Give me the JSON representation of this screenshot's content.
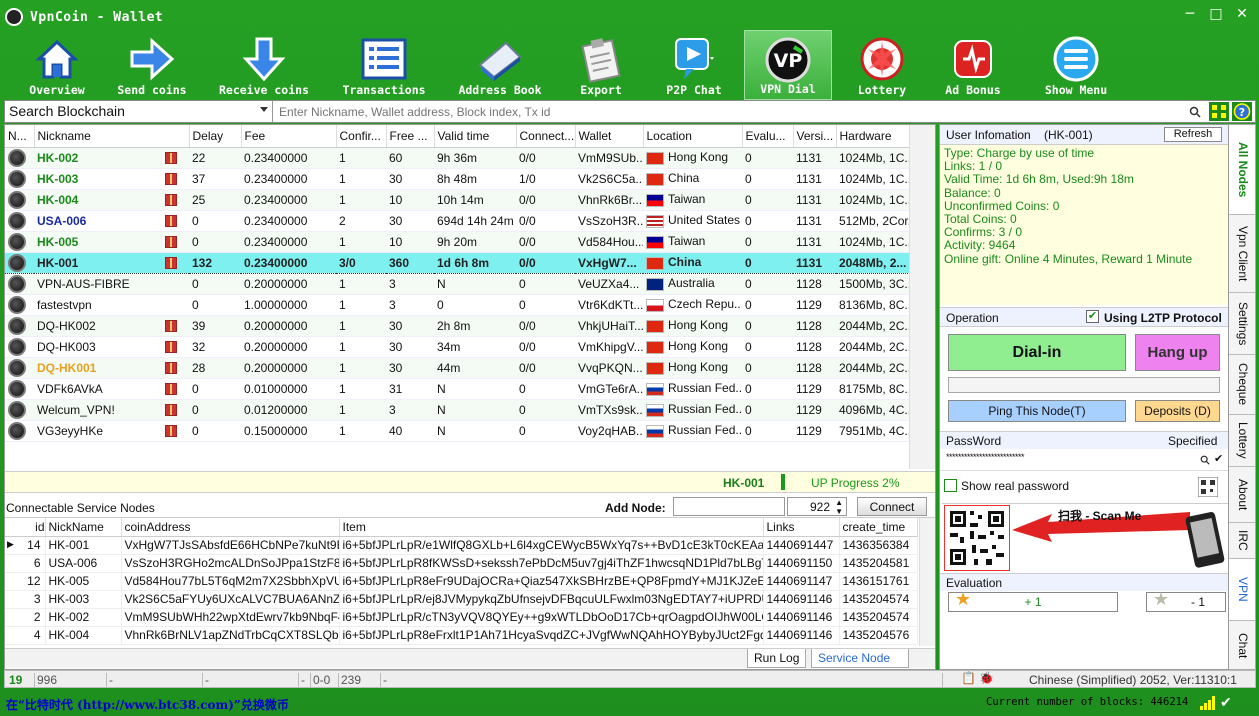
{
  "window": {
    "title": "VpnCoin - Wallet",
    "min": "─",
    "max": "□",
    "close": "✕",
    "logo_text": "V"
  },
  "toolbar": [
    {
      "name": "overview",
      "label": "Overview",
      "icon": "house-icon"
    },
    {
      "name": "send-coins",
      "label": "Send coins",
      "icon": "arrow-right-icon"
    },
    {
      "name": "receive-coins",
      "label": "Receive coins",
      "icon": "arrow-down-icon"
    },
    {
      "name": "transactions",
      "label": "Transactions",
      "icon": "list-icon"
    },
    {
      "name": "address-book",
      "label": "Address Book",
      "icon": "book-icon"
    },
    {
      "name": "export",
      "label": "Export",
      "icon": "clipboard-icon"
    },
    {
      "name": "p2p-chat",
      "label": "P2P Chat",
      "icon": "video-chat-icon"
    },
    {
      "name": "vpn-dial",
      "label": "VPN Dial",
      "icon": "vpn-logo-icon"
    },
    {
      "name": "lottery",
      "label": "Lottery",
      "icon": "lottery-icon"
    },
    {
      "name": "ad-bonus",
      "label": "Ad Bonus",
      "icon": "bonus-icon"
    },
    {
      "name": "show-menu",
      "label": "Show Menu",
      "icon": "menu-icon"
    }
  ],
  "search": {
    "selected": "Search Blockchain",
    "placeholder": "Enter Nickname, Wallet address, Block index, Tx id"
  },
  "nodes": {
    "columns": [
      "N...",
      "Nickname",
      "Delay",
      "Fee",
      "Confir...",
      "Free ...",
      "Valid time",
      "Connect...",
      "Wallet",
      "Location",
      "Evalu...",
      "Versi...",
      "Hardware"
    ],
    "rows": [
      {
        "nick": "HK-002",
        "color": "green",
        "gift": true,
        "delay": "22",
        "fee": "0.23400000",
        "confirm": "1",
        "free": "60",
        "valid": "9h 36m",
        "connect": "0/0",
        "wallet": "VmM9SUb...",
        "flag": "hk",
        "location": "Hong Kong",
        "eval": "0",
        "version": "1131",
        "hardware": "1024Mb, 1C..."
      },
      {
        "nick": "HK-003",
        "color": "green",
        "gift": true,
        "delay": "37",
        "fee": "0.23400000",
        "confirm": "1",
        "free": "30",
        "valid": "8h 48m",
        "connect": "1/0",
        "wallet": "Vk2S6C5a...",
        "flag": "cn",
        "location": "China",
        "eval": "0",
        "version": "1131",
        "hardware": "1024Mb, 1C..."
      },
      {
        "nick": "HK-004",
        "color": "green",
        "gift": true,
        "delay": "25",
        "fee": "0.23400000",
        "confirm": "1",
        "free": "10",
        "valid": "10h 14m",
        "connect": "0/0",
        "wallet": "VhnRk6Br...",
        "flag": "tw",
        "location": "Taiwan",
        "eval": "0",
        "version": "1131",
        "hardware": "1024Mb, 1C..."
      },
      {
        "nick": "USA-006",
        "color": "blue",
        "gift": true,
        "delay": "0",
        "fee": "0.23400000",
        "confirm": "2",
        "free": "30",
        "valid": "694d 14h 24m",
        "connect": "0/0",
        "wallet": "VsSzoH3R...",
        "flag": "us",
        "location": "United States",
        "eval": "0",
        "version": "1131",
        "hardware": "512Mb, 2Cor..."
      },
      {
        "nick": "HK-005",
        "color": "green",
        "gift": true,
        "delay": "0",
        "fee": "0.23400000",
        "confirm": "1",
        "free": "10",
        "valid": "9h 20m",
        "connect": "0/0",
        "wallet": "Vd584Hou...",
        "flag": "tw",
        "location": "Taiwan",
        "eval": "0",
        "version": "1131",
        "hardware": "1024Mb, 1C..."
      },
      {
        "nick": "HK-001",
        "color": "green",
        "gift": true,
        "selected": true,
        "delay": "132",
        "fee": "0.23400000",
        "confirm": "3/0",
        "free": "360",
        "valid": "1d 6h 8m",
        "connect": "0/0",
        "wallet": "VxHgW7...",
        "flag": "cn",
        "location": "China",
        "eval": "0",
        "version": "1131",
        "hardware": "2048Mb, 2..."
      },
      {
        "nick": "VPN-AUS-FIBRE",
        "color": "black",
        "gift": false,
        "delay": "0",
        "fee": "0.20000000",
        "confirm": "1",
        "free": "3",
        "valid": "N",
        "connect": "0",
        "wallet": "VeUZXa4...",
        "flag": "au",
        "location": "Australia",
        "eval": "0",
        "version": "1128",
        "hardware": "1500Mb, 3C..."
      },
      {
        "nick": "fastestvpn",
        "color": "black",
        "gift": false,
        "delay": "0",
        "fee": "1.00000000",
        "confirm": "1",
        "free": "3",
        "valid": "0",
        "connect": "0",
        "wallet": "Vtr6KdKTt...",
        "flag": "cz",
        "location": "Czech Repu...",
        "eval": "0",
        "version": "1129",
        "hardware": "8136Mb, 8C..."
      },
      {
        "nick": "DQ-HK002",
        "color": "black",
        "gift": true,
        "delay": "39",
        "fee": "0.20000000",
        "confirm": "1",
        "free": "30",
        "valid": "2h 8m",
        "connect": "0/0",
        "wallet": "VhkjUHaiT...",
        "flag": "hk",
        "location": "Hong Kong",
        "eval": "0",
        "version": "1128",
        "hardware": "2044Mb, 2C..."
      },
      {
        "nick": "DQ-HK003",
        "color": "black",
        "gift": true,
        "delay": "32",
        "fee": "0.20000000",
        "confirm": "1",
        "free": "30",
        "valid": "34m",
        "connect": "0/0",
        "wallet": "VmKhipgV...",
        "flag": "hk",
        "location": "Hong Kong",
        "eval": "0",
        "version": "1128",
        "hardware": "2044Mb, 2C..."
      },
      {
        "nick": "DQ-HK001",
        "color": "orange",
        "gift": true,
        "delay": "28",
        "fee": "0.20000000",
        "confirm": "1",
        "free": "30",
        "valid": "44m",
        "connect": "0/0",
        "wallet": "VvqPKQN...",
        "flag": "hk",
        "location": "Hong Kong",
        "eval": "0",
        "version": "1128",
        "hardware": "2044Mb, 2C..."
      },
      {
        "nick": "VDFk6AVkA",
        "color": "black",
        "gift": true,
        "delay": "0",
        "fee": "0.01000000",
        "confirm": "1",
        "free": "31",
        "valid": "N",
        "connect": "0",
        "wallet": "VmGTe6rA...",
        "flag": "ru",
        "location": "Russian Fed...",
        "eval": "0",
        "version": "1129",
        "hardware": "8175Mb, 8C..."
      },
      {
        "nick": "Welcum_VPN!",
        "color": "black",
        "gift": true,
        "delay": "0",
        "fee": "0.01200000",
        "confirm": "1",
        "free": "3",
        "valid": "N",
        "connect": "0",
        "wallet": "VmTXs9sk...",
        "flag": "ru",
        "location": "Russian Fed...",
        "eval": "0",
        "version": "1129",
        "hardware": "4096Mb, 4C..."
      },
      {
        "nick": "VG3eyyHKe",
        "color": "black",
        "gift": true,
        "delay": "0",
        "fee": "0.15000000",
        "confirm": "1",
        "free": "40",
        "valid": "N",
        "connect": "0",
        "wallet": "Voy2qHAB...",
        "flag": "ru",
        "location": "Russian Fed...",
        "eval": "0",
        "version": "1129",
        "hardware": "7951Mb, 4C..."
      }
    ]
  },
  "upbar": {
    "node": "HK-001",
    "progress": "UP Progress 2%"
  },
  "connectable": {
    "label": "Connectable Service Nodes",
    "add_label": "Add Node:",
    "port": "922",
    "connect": "Connect"
  },
  "service": {
    "columns": [
      "id",
      "NickName",
      "coinAddress",
      "Item",
      "Links",
      "create_time"
    ],
    "rows": [
      {
        "marker": "▶",
        "id": "14",
        "nick": "HK-001",
        "addr": "VxHgW7TJsSAbsfdE66HCbNPe7kuNt9BGwi",
        "item": "i6+5bfJPLrLpR/e1WlfQ8GXLb+L6l4xgCEWycB5WxYq7s++BvD1cE3kT0cKEAapXP6qD",
        "links": "1440691447",
        "ctime": "1436356384"
      },
      {
        "marker": "",
        "id": "6",
        "nick": "USA-006",
        "addr": "VsSzoH3RGHo2mcALDnSoJPpa1StzF8aQPl",
        "item": "i6+5bfJPLrLpR8fKWSsD+sekssh7ePbDcM5uv7gj4iThZF1hwcsqND1Pld7bLBgTxh5z9vg",
        "links": "1440691150",
        "ctime": "1435204581"
      },
      {
        "marker": "",
        "id": "12",
        "nick": "HK-005",
        "addr": "Vd584Hou77bL5T6qM2m7X2SbbhXpVU1xvi",
        "item": "i6+5bfJPLrLpR8eFr9UDajOCRa+Qiaz547XkSBHrzBE+QP8FpmdY+MJ1KJZeE9Vac5mL",
        "links": "1440691147",
        "ctime": "1436151761"
      },
      {
        "marker": "",
        "id": "3",
        "nick": "HK-003",
        "addr": "Vk2S6C5aFYUy6UXcALVC7BUA6ANnZRW",
        "item": "i6+5bfJPLrLpR/ej8JVMypykqZbUfnsejvDFBqcuULFwxlm03NgEDTAY7+iUPRDUJs+NsA",
        "links": "1440691146",
        "ctime": "1435204574"
      },
      {
        "marker": "",
        "id": "2",
        "nick": "HK-002",
        "addr": "VmM9SUbWHh22wpXtdEwrv7kb9NbqF4kbS",
        "item": "i6+5bfJPLrLpR/cTN3yVQV8QYEy++g9xWTLDbOoD17Cb+qrOagpdOIJhW00LOXBh8Trq",
        "links": "1440691146",
        "ctime": "1435204574"
      },
      {
        "marker": "",
        "id": "4",
        "nick": "HK-004",
        "addr": "VhnRk6BrNLV1apZNdTrbCqCXT8SLQbaAD",
        "item": "i6+5bfJPLrLpR8eFrxlt1P1Ah71HcyaSvqdZC+JVgfWwNQAhHOYBybyJUct2FgqhFk7MW",
        "links": "1440691146",
        "ctime": "1435204576"
      }
    ]
  },
  "btabs": {
    "runlog": "Run Log",
    "service": "Service Node"
  },
  "status": {
    "c1": "19",
    "c2": "996",
    "c3": "-",
    "c4": "-",
    "c5": "-",
    "c6": "-",
    "c7": "-",
    "c8": "0-0",
    "c9": "239",
    "lang": "Chinese (Simplified) 2052, Ver:11310:1"
  },
  "footer": {
    "ad": "在“比特时代 (http://www.btc38.com)”兑换微币",
    "blocks": "Current number of blocks: 446214"
  },
  "userinfo": {
    "title": "User Infomation",
    "node": "(HK-001)",
    "refresh": "Refresh",
    "lines": [
      "Type: Charge by use of time",
      "Links: 1 / 0",
      "Valid Time: 1d 6h 8m, Used:9h 18m",
      "Balance: 0",
      "Unconfirmed Coins: 0",
      "Total Coins: 0",
      "Confirms: 3 / 0",
      "Activity: 9464",
      "Online gift: Online 4 Minutes, Reward 1 Minute"
    ]
  },
  "operation": {
    "title": "Operation",
    "l2tp": "Using L2TP Protocol",
    "dial": "Dial-in",
    "hang": "Hang up",
    "ping": "Ping This Node(T)",
    "deposits": "Deposits (D)"
  },
  "password": {
    "title": "PassWord",
    "specified": "Specified",
    "value": "**************************",
    "show": "Show real password"
  },
  "scan": {
    "text": "扫我 - Scan Me"
  },
  "evaluation": {
    "title": "Evaluation",
    "plus": "+ 1",
    "minus": "- 1"
  },
  "vtabs": [
    "All Nodes",
    "Vpn Client",
    "Settings",
    "Cheque",
    "Lottery",
    "About",
    "IRC",
    "VPN",
    "Chat"
  ],
  "colors": {
    "green": "#1a8a1a",
    "blue": "#1a2aa0",
    "orange": "#e8a020",
    "accent": "#25a023"
  }
}
